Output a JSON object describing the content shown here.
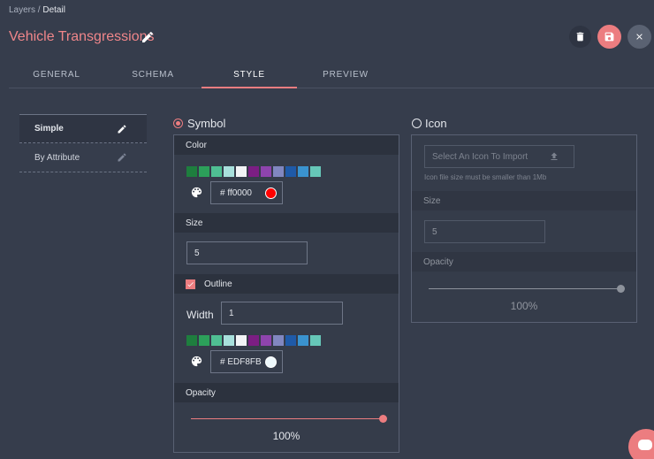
{
  "breadcrumb": {
    "parent": "Layers",
    "separator": " / ",
    "current": "Detail"
  },
  "page": {
    "title": "Vehicle Transgressions"
  },
  "toolbar": {
    "delete_icon": "trash-icon",
    "save_icon": "save-icon",
    "close_icon": "close-icon"
  },
  "tabs": [
    {
      "label": "GENERAL",
      "active": false
    },
    {
      "label": "SCHEMA",
      "active": false
    },
    {
      "label": "STYLE",
      "active": true
    },
    {
      "label": "PREVIEW",
      "active": false
    }
  ],
  "style_types": [
    {
      "label": "Simple",
      "selected": true
    },
    {
      "label": "By Attribute",
      "selected": false
    }
  ],
  "symbol": {
    "label": "Symbol",
    "selected": true,
    "color_label": "Color",
    "palette": [
      "#1e7e3e",
      "#2ca05a",
      "#4fbf93",
      "#a8e0dc",
      "#f2f4f6",
      "#7b1e83",
      "#8e44ad",
      "#8187c0",
      "#1f5aa8",
      "#3a93cf",
      "#66c7b8"
    ],
    "fill_hex": "# ff0000",
    "fill_color": "#ff0000",
    "size_label": "Size",
    "size_value": "5",
    "outline_label": "Outline",
    "outline_checked": true,
    "width_label": "Width",
    "width_value": "1",
    "outline_hex": "# EDF8FB",
    "outline_color": "#edf8fb",
    "opacity_label": "Opacity",
    "opacity_value": "100%",
    "opacity_level": 1.0
  },
  "icon": {
    "label": "Icon",
    "selected": false,
    "import_placeholder": "Select An Icon To Import",
    "size_hint": "Icon file size must be smaller than 1Mb",
    "size_label": "Size",
    "size_value": "5",
    "opacity_label": "Opacity",
    "opacity_value": "100%",
    "opacity_level": 1.0
  }
}
